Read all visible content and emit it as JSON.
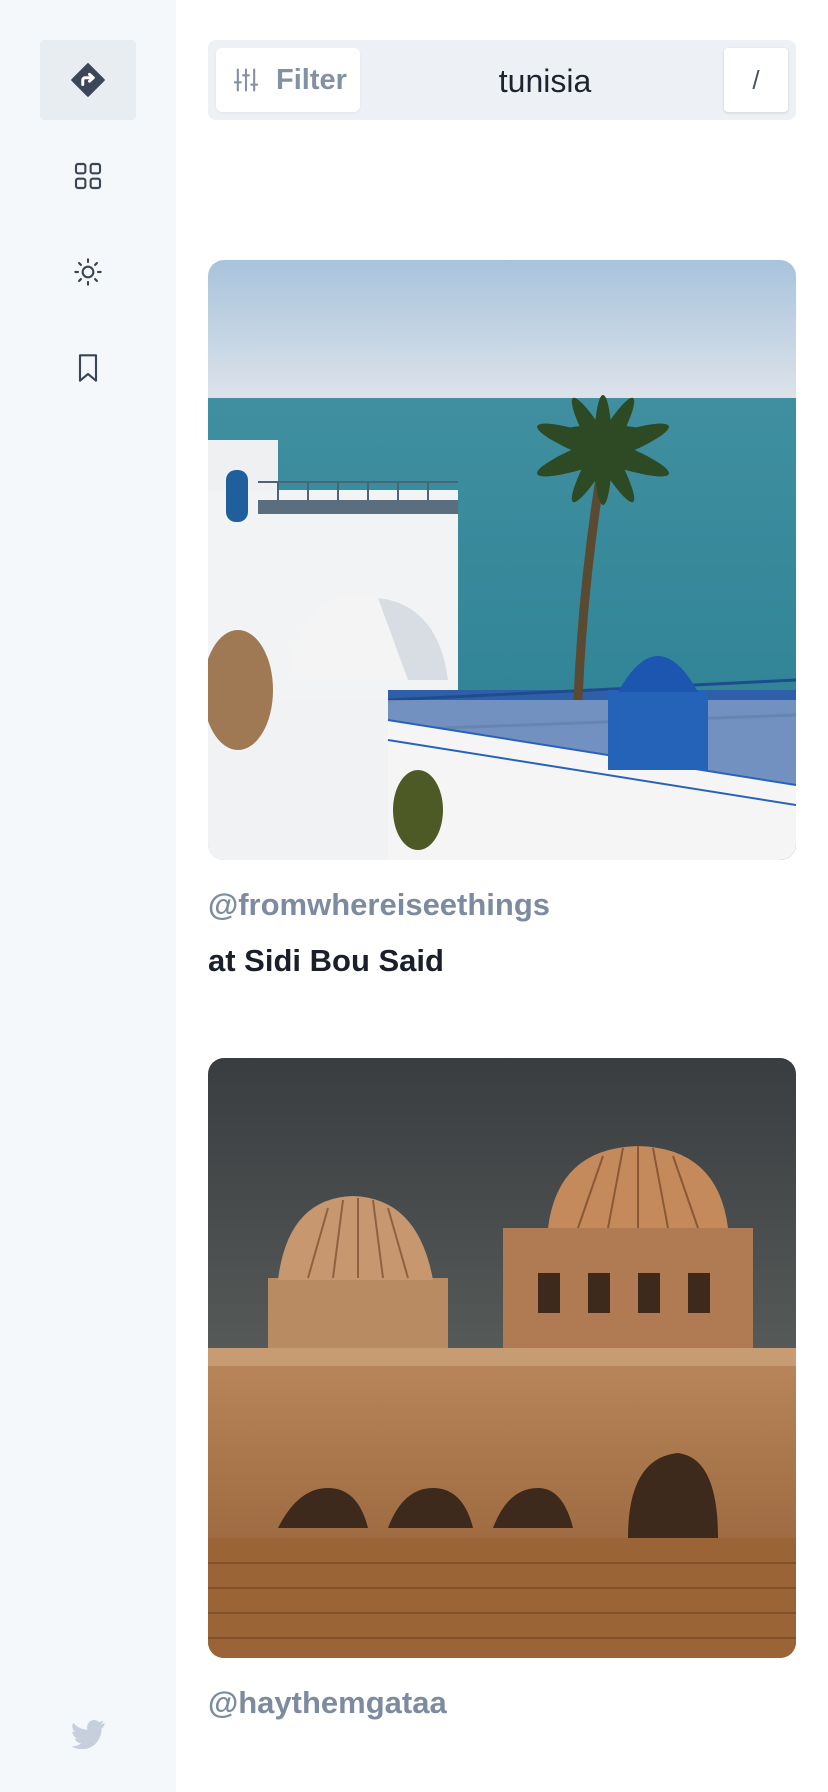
{
  "sidebar": {
    "items": [
      {
        "name": "directions-icon",
        "active": true
      },
      {
        "name": "grid-icon",
        "active": false
      },
      {
        "name": "sun-icon",
        "active": false
      },
      {
        "name": "bookmark-icon",
        "active": false
      }
    ],
    "footer_icon": "twitter-icon"
  },
  "search": {
    "filter_label": "Filter",
    "query": "tunisia",
    "shortcut_key": "/"
  },
  "feed": [
    {
      "username": "@fromwhereiseethings",
      "caption": "at Sidi Bou Said",
      "image_subject": "Sidi Bou Said white and blue terrace overlooking the sea with palm tree"
    },
    {
      "username": "@haythemgataa",
      "caption": "",
      "image_subject": "Ribbed domes of the Great Mosque of Kairouan under a stormy sky"
    }
  ],
  "colors": {
    "sidebar_bg": "#f5f8fb",
    "accent_dark": "#3b4658",
    "username": "#7d8ba0",
    "caption": "#1a1f2b"
  }
}
